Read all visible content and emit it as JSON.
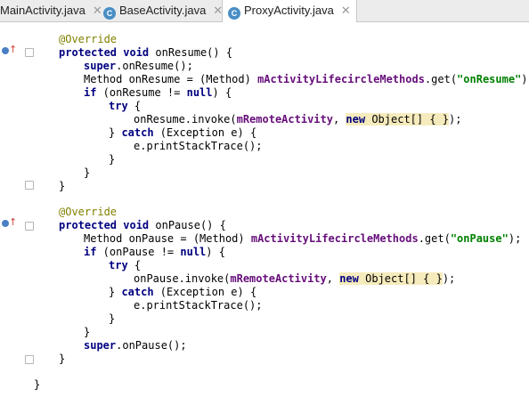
{
  "tabs": [
    {
      "label": "MainActivity.java",
      "icon": "close-icon",
      "active": false
    },
    {
      "label": "BaseActivity.java",
      "icon": "class-icon",
      "active": false
    },
    {
      "label": "ProxyActivity.java",
      "icon": "class-icon",
      "active": true
    }
  ],
  "tab_icon_letter": "C",
  "tab_close_glyph": "✕",
  "code": {
    "l1": "@Override",
    "l2_kw": "protected void",
    "l2_rest": " onResume() {",
    "l3_kw": "super",
    "l3_rest": ".onResume();",
    "l4_a": "Method onResume = (Method) ",
    "l4_field": "mActivityLifecircleMethods",
    "l4_b": ".get(",
    "l4_str": "\"onResume\"",
    "l4_c": ");",
    "l5_kw1": "if",
    "l5_a": " (onResume != ",
    "l5_kw2": "null",
    "l5_b": ") {",
    "l6_kw": "try",
    "l6_rest": " {",
    "l7_a": "onResume.invoke(",
    "l7_field": "mRemoteActivity",
    "l7_b": ", ",
    "l7_kw": "new",
    "l7_c": " Object[] { }",
    "l7_d": ");",
    "l8_a": "} ",
    "l8_kw": "catch",
    "l8_b": " (Exception e) {",
    "l9": "e.printStackTrace();",
    "close": "}",
    "p1": "@Override",
    "p2_kw": "protected void",
    "p2_rest": " onPause() {",
    "p3_a": "Method onPause = (Method) ",
    "p3_field": "mActivityLifecircleMethods",
    "p3_b": ".get(",
    "p3_str": "\"onPause\"",
    "p3_c": ");",
    "p4_kw1": "if",
    "p4_a": " (onPause != ",
    "p4_kw2": "null",
    "p4_b": ") {",
    "p5_kw": "try",
    "p5_rest": " {",
    "p6_a": "onPause.invoke(",
    "p6_field": "mRemoteActivity",
    "p6_b": ", ",
    "p6_kw": "new",
    "p6_c": " Object[] { }",
    "p6_d": ");",
    "p7_a": "} ",
    "p7_kw": "catch",
    "p7_b": " (Exception e) {",
    "p8": "e.printStackTrace();",
    "p9_kw": "super",
    "p9_rest": ".onPause();"
  },
  "colors": {
    "keyword": "#000080",
    "annotation": "#808000",
    "field": "#660e7a",
    "string": "#008000",
    "highlight": "#f6ebbc"
  }
}
